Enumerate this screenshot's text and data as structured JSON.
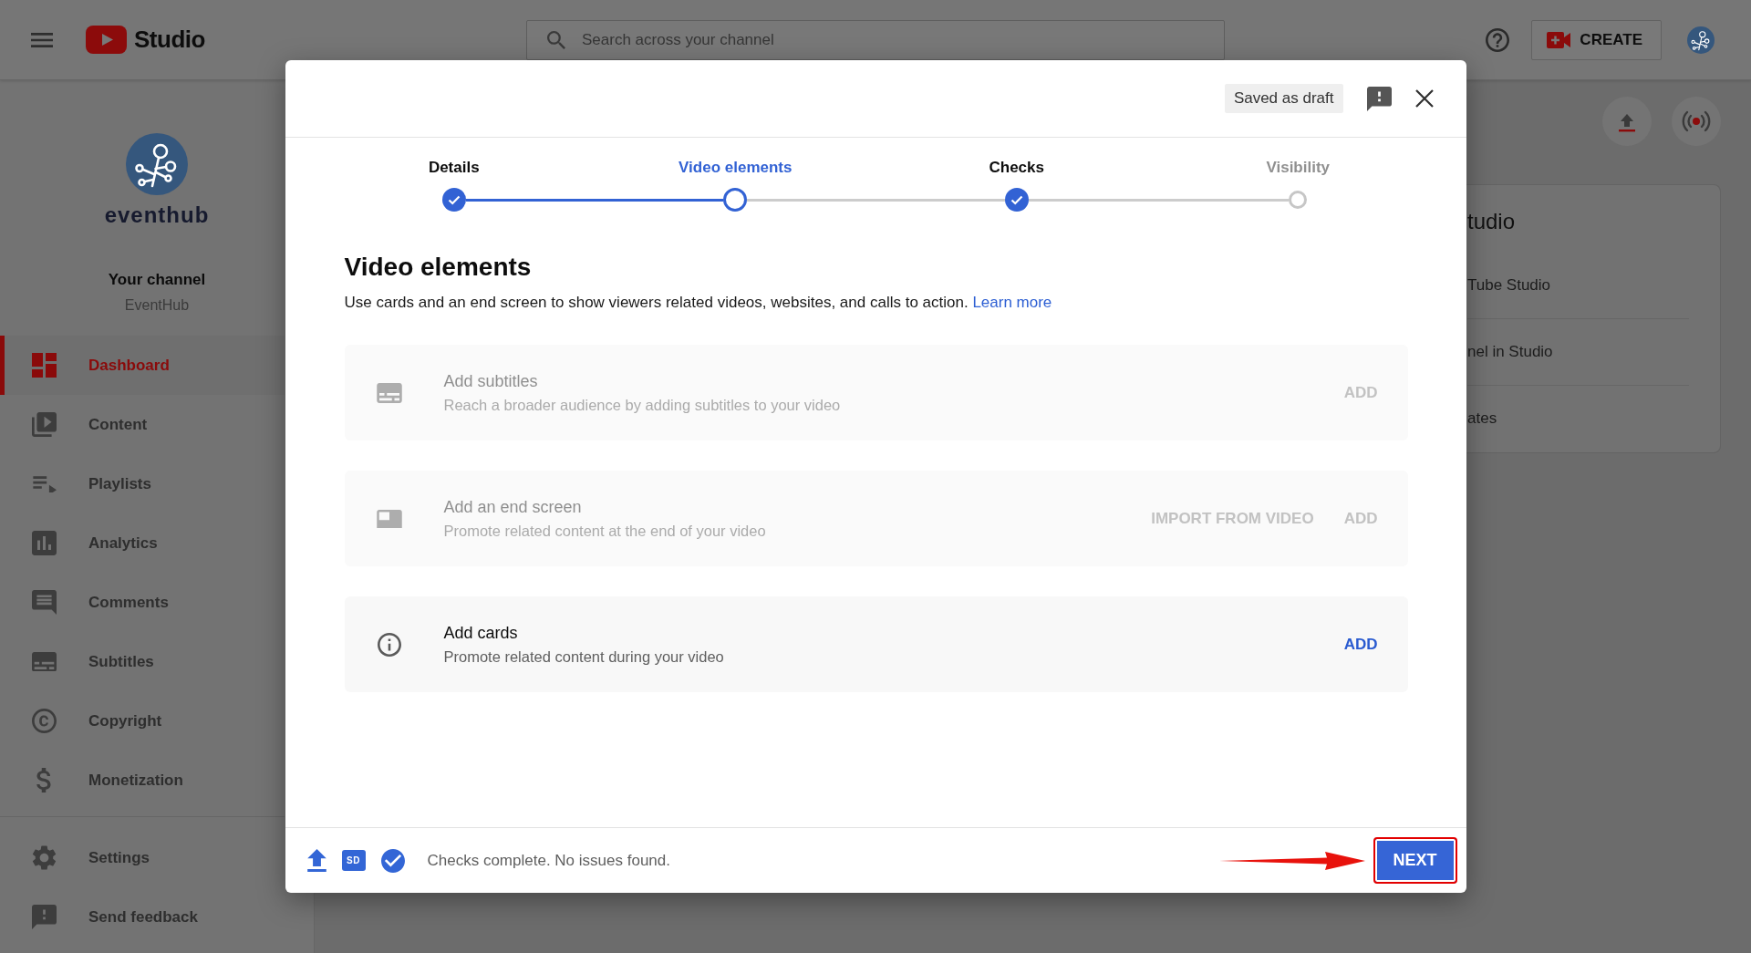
{
  "topbar": {
    "logo_text": "Studio",
    "search": {
      "placeholder": "Search across your channel"
    },
    "create_button": "CREATE"
  },
  "sidebar": {
    "logo_text": "eventhub",
    "channel_label": "Your channel",
    "channel_name": "EventHub",
    "nav": [
      {
        "label": "Dashboard",
        "selected": true
      },
      {
        "label": "Content",
        "selected": false
      },
      {
        "label": "Playlists",
        "selected": false
      },
      {
        "label": "Analytics",
        "selected": false
      },
      {
        "label": "Comments",
        "selected": false
      },
      {
        "label": "Subtitles",
        "selected": false
      },
      {
        "label": "Copyright",
        "selected": false
      },
      {
        "label": "Monetization",
        "selected": false
      }
    ],
    "footer_nav": [
      {
        "label": "Settings",
        "selected": false
      },
      {
        "label": "Send feedback",
        "selected": false
      }
    ]
  },
  "background_card": {
    "title": "tudio",
    "items": [
      "Tube Studio",
      "nel in Studio",
      "ates"
    ]
  },
  "dialog": {
    "save_status": "Saved as draft",
    "steps": [
      {
        "label": "Details",
        "done": true,
        "selected": false
      },
      {
        "label": "Video elements",
        "done": false,
        "selected": true
      },
      {
        "label": "Checks",
        "done": true,
        "selected": false
      },
      {
        "label": "Visibility",
        "done": false,
        "selected": false
      }
    ],
    "title": "Video elements",
    "description": "Use cards and an end screen to show viewers related videos, websites, and calls to action.",
    "learn_more": "Learn more",
    "cards": [
      {
        "title": "Add subtitles",
        "description": "Reach a broader audience by adding subtitles to your video",
        "disabled": true,
        "actions": [
          "ADD"
        ]
      },
      {
        "title": "Add an end screen",
        "description": "Promote related content at the end of your video",
        "disabled": true,
        "actions": [
          "IMPORT FROM VIDEO",
          "ADD"
        ]
      },
      {
        "title": "Add cards",
        "description": "Promote related content during your video",
        "disabled": false,
        "actions": [
          "ADD"
        ]
      }
    ],
    "footer": {
      "quality_badge": "SD",
      "status": "Checks complete. No issues found.",
      "next_button": {
        "label": "NEXT",
        "highlighted": true
      }
    }
  }
}
